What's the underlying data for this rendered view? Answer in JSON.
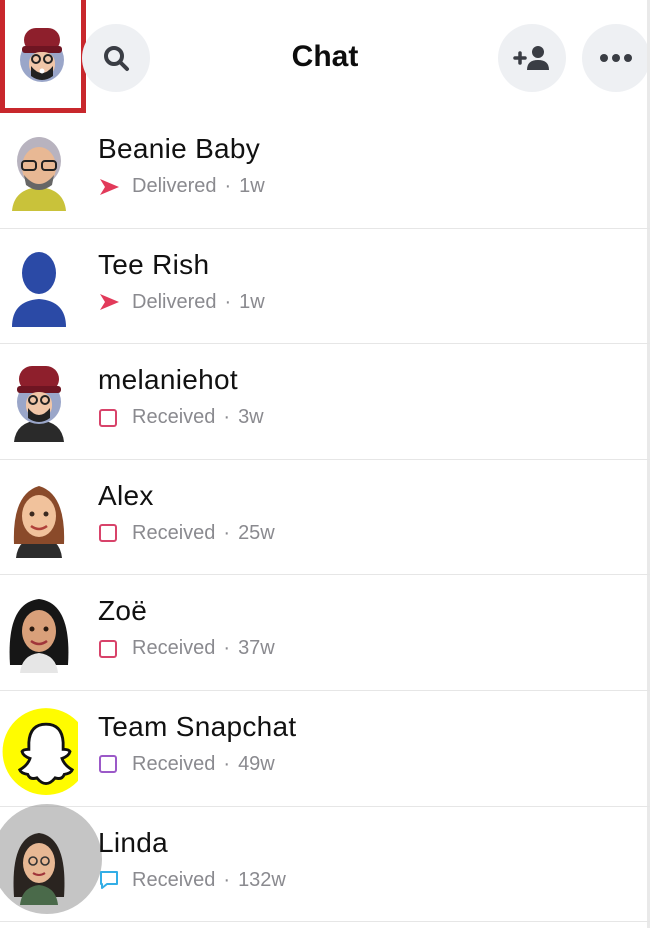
{
  "header": {
    "title": "Chat",
    "icons": {
      "search": "search-icon",
      "add_friend": "add-friend-icon",
      "more": "more-icon"
    }
  },
  "colors": {
    "delivered": "#e23a5a",
    "received_red": "#d8436a",
    "received_purple": "#9b59c8",
    "received_blue": "#33aee6",
    "highlight": "#c8272c",
    "snap_yellow": "#fffc00"
  },
  "chats": [
    {
      "name": "Beanie Baby",
      "status": "Delivered",
      "time": "1w",
      "icon": "delivered-arrow-icon"
    },
    {
      "name": "Tee Rish",
      "status": "Delivered",
      "time": "1w",
      "icon": "delivered-arrow-icon"
    },
    {
      "name": "melaniehot",
      "status": "Received",
      "time": "3w",
      "icon": "received-square-icon"
    },
    {
      "name": "Alex",
      "status": "Received",
      "time": "25w",
      "icon": "received-square-icon"
    },
    {
      "name": "Zoë",
      "status": "Received",
      "time": "37w",
      "icon": "received-square-icon"
    },
    {
      "name": "Team Snapchat",
      "status": "Received",
      "time": "49w",
      "icon": "received-square-icon"
    },
    {
      "name": "Linda",
      "status": "Received",
      "time": "132w",
      "icon": "received-chat-icon"
    }
  ]
}
